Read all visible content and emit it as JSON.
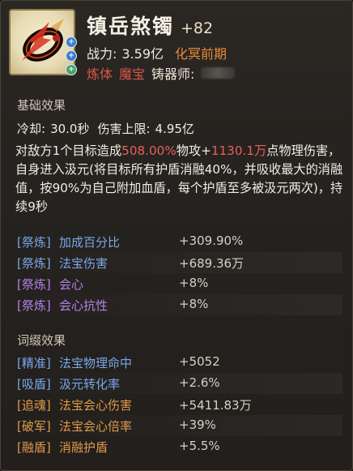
{
  "item": {
    "name": "镇岳煞镯",
    "enhance": "+82",
    "power_label": "战力:",
    "power_value": "3.59亿",
    "realm": "化冥前期",
    "tag1": "炼体",
    "tag2": "魔宝",
    "forger_label": "铸器师:",
    "badges": [
      "+",
      "+",
      "+"
    ],
    "icon": "bracelet-icon"
  },
  "basic": {
    "title": "基础效果",
    "cooldown_label": "冷却:",
    "cooldown_value": "30.0秒",
    "damage_cap_label": "伤害上限:",
    "damage_cap_value": "4.95亿",
    "desc_part1": "对敌方1个目标造成",
    "desc_pct": "508.00%",
    "desc_part2": "物攻+",
    "desc_flat": "1130.1万",
    "desc_part3": "点物理伤害，自身进入汲元(将目标所有护盾消融40%，并吸收最大的消融值，按90%为自己附加血盾，每个护盾至多被汲元两次)，持续9秒"
  },
  "refine": [
    {
      "tag": "[祭炼]",
      "name": "加成百分比",
      "value": "+309.90%",
      "tone": "blue"
    },
    {
      "tag": "[祭炼]",
      "name": "法宝伤害",
      "value": "+689.36万",
      "tone": "blue"
    },
    {
      "tag": "[祭炼]",
      "name": "会心",
      "value": "+8%",
      "tone": "purple"
    },
    {
      "tag": "[祭炼]",
      "name": "会心抗性",
      "value": "+8%",
      "tone": "purple"
    }
  ],
  "affix": {
    "title": "词缀效果",
    "rows": [
      {
        "tag": "[精准]",
        "name": "法宝物理命中",
        "value": "+5052",
        "tone": "blue"
      },
      {
        "tag": "[吸盾]",
        "name": "汲元转化率",
        "value": "+2.6%",
        "tone": "blue"
      },
      {
        "tag": "[追魂]",
        "name": "法宝会心伤害",
        "value": "+5411.83万",
        "tone": "orange"
      },
      {
        "tag": "[破军]",
        "name": "法宝会心倍率",
        "value": "+39%",
        "tone": "orange"
      },
      {
        "tag": "[融盾]",
        "name": "消融护盾",
        "value": "+5.5%",
        "tone": "orange"
      }
    ]
  },
  "colors": {
    "blue_stat": "#79a8e8",
    "purple_stat": "#b482e8",
    "orange_stat": "#e09a4a",
    "realm": "#e48b3a",
    "red_tag": "#d9574a"
  }
}
